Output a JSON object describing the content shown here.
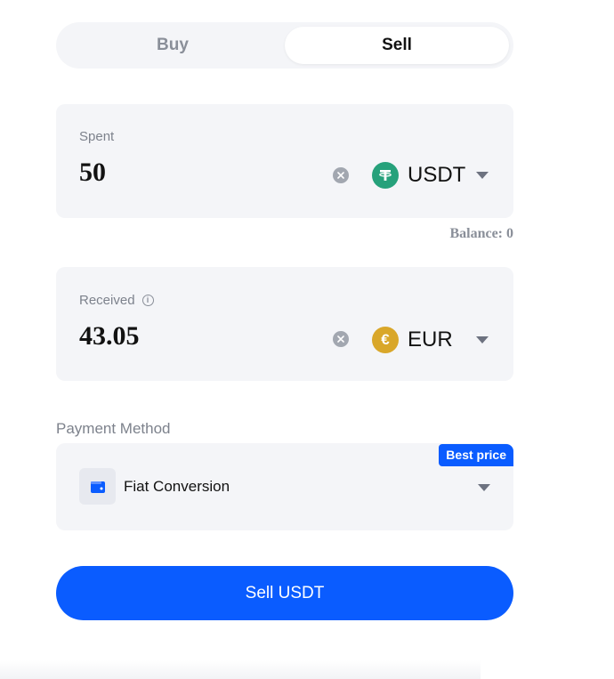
{
  "tabs": [
    {
      "label": "Buy",
      "active": false
    },
    {
      "label": "Sell",
      "active": true
    }
  ],
  "spent": {
    "label": "Spent",
    "amount": "50",
    "asset": "USDT",
    "asset_icon": "usdt-coin-icon",
    "asset_color": "#26a17b"
  },
  "balance": {
    "text": "Balance: 0"
  },
  "received": {
    "label": "Received",
    "amount": "43.05",
    "asset": "EUR",
    "asset_icon": "euro-coin-icon",
    "asset_symbol": "€",
    "asset_color": "#d9a72a"
  },
  "payment": {
    "title": "Payment Method",
    "badge": "Best price",
    "method": "Fiat Conversion",
    "method_icon": "wallet-icon"
  },
  "cta": {
    "label": "Sell USDT",
    "color": "#0a5cff"
  }
}
